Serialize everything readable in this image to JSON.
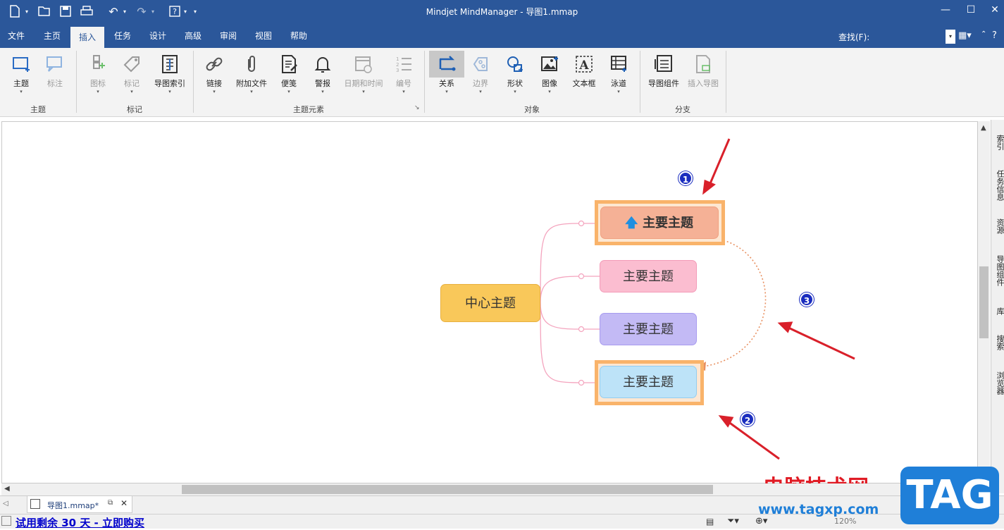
{
  "window": {
    "title": "Mindjet MindManager - 导图1.mmap"
  },
  "menu": {
    "tabs": [
      "文件",
      "主页",
      "插入",
      "任务",
      "设计",
      "高级",
      "审阅",
      "视图",
      "帮助"
    ],
    "active": "插入",
    "find_label": "查找(F):"
  },
  "ribbon": {
    "buttons": {
      "topic": "主题",
      "callout": "标注",
      "icon": "图标",
      "tag": "标记",
      "map_index": "导图索引",
      "link": "链接",
      "attachment": "附加文件",
      "note": "便笺",
      "alarm": "警报",
      "date_time": "日期和时间",
      "numbering": "编号",
      "relationship": "关系",
      "boundary": "边界",
      "shape": "形状",
      "image": "图像",
      "text_box": "文本框",
      "swimlane": "泳道",
      "map_part": "导图组件",
      "insert_map": "插入导图"
    },
    "groups": {
      "topic": "主题",
      "marker": "标记",
      "topic_elements": "主题元素",
      "objects": "对象",
      "branch": "分支"
    }
  },
  "map": {
    "central": "中心主题",
    "topics": [
      "主要主题",
      "主要主题",
      "主要主题",
      "主要主题"
    ],
    "badges": [
      "1",
      "2",
      "3"
    ]
  },
  "right_panel": [
    "索引",
    "任务信息",
    "资源",
    "导图组件",
    "库",
    "搜索",
    "浏览器"
  ],
  "doc_tab": {
    "name": "导图1.mmap*"
  },
  "status": {
    "trial": "试用剩余 30 天 - 立即购买",
    "zoom": "120%"
  },
  "watermark": {
    "title": "电脑技术网",
    "url": "www.tagxp.com",
    "logo": "TAG"
  },
  "colors": {
    "titlebar": "#2b579a",
    "central": "#f9c85a",
    "topic1": "#f5b196",
    "topic2": "#fbbdd0",
    "topic3": "#c3baf5",
    "topic4": "#bde3f8",
    "arrow": "#d9202a"
  }
}
